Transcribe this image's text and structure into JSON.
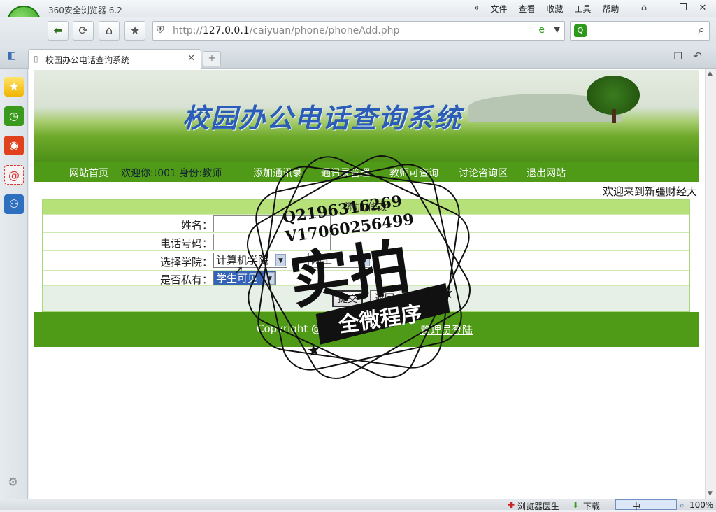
{
  "browser": {
    "app_title": "360安全浏览器 6.2",
    "menu": [
      "文件",
      "查看",
      "收藏",
      "工具",
      "帮助"
    ],
    "address_url_host": "http://",
    "address_url_main": "127.0.0.1",
    "address_url_path": "/caiyuan/phone/phoneAdd.php",
    "tab_title": "校园办公电话查询系统",
    "status": {
      "doctor": "浏览器医生",
      "download": "下载",
      "ime": "中",
      "zoom": "100%"
    }
  },
  "site": {
    "banner_title": "校园办公电话查询系统",
    "nav": {
      "home": "网站首页",
      "welcome": "欢迎你:t001 身份:教师",
      "add": "添加通讯录",
      "manage": "通讯录管理",
      "teacher_query": "教师可查询",
      "forum": "讨论咨询区",
      "logout": "退出网站"
    },
    "marquee": "欢迎来到新疆财经大"
  },
  "form": {
    "heading": "添加/修改",
    "name_label": "姓名：",
    "name_value": "",
    "phone_label": "电话号码：",
    "phone_value": "",
    "college_label": "选择学院：",
    "college_value": "计算机学院",
    "dept_value": "网工",
    "private_label": "是否私有：",
    "private_value": "学生可见",
    "submit": "提交",
    "back": "返回"
  },
  "footer": {
    "copyright": "Copyright @",
    "admin_link": "管理员登陆"
  },
  "watermark": {
    "qq": "Q2196316269",
    "wechat": "V17060256499",
    "big": "实拍",
    "small": "全微程序"
  }
}
